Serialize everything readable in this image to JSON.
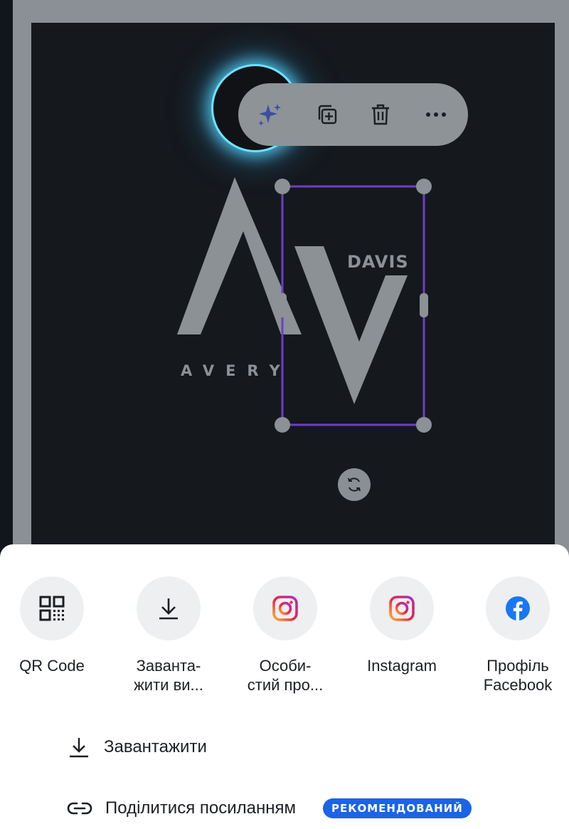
{
  "canvas": {
    "toolbar": {
      "magic_icon": "sparkles-icon",
      "duplicate_icon": "duplicate-icon",
      "delete_icon": "trash-icon",
      "more_icon": "more-icon"
    },
    "logo": {
      "title_text": "DAVIS",
      "subtitle_text": "AVERY"
    },
    "rotate_icon": "rotate-icon"
  },
  "share_sheet": {
    "targets": [
      {
        "label": "QR Code",
        "icon": "qr-code-icon"
      },
      {
        "label": "Заванта-\nжити ви...",
        "icon": "download-icon"
      },
      {
        "label": "Особи-\nстий про...",
        "icon": "instagram-icon"
      },
      {
        "label": "Instagram",
        "icon": "instagram-icon"
      },
      {
        "label": "Профіль\nFacebook",
        "icon": "facebook-icon"
      }
    ],
    "download_label": "Завантажити",
    "share_link_label": "Поділитися посиланням",
    "recommended_badge": "РЕКОМЕНДОВАНИЙ"
  },
  "colors": {
    "accent_purple": "#6b3fc7",
    "glow_cyan": "#56d6ff",
    "badge_blue": "#1b63e8",
    "facebook_blue": "#1877f2"
  }
}
